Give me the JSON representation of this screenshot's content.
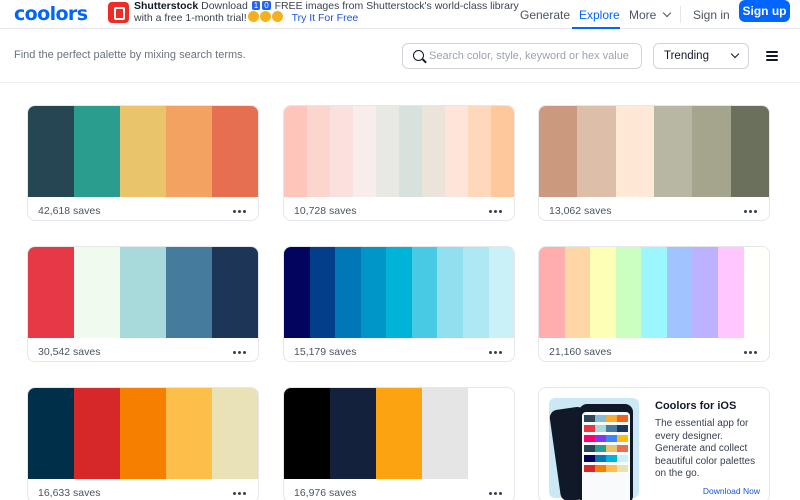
{
  "header": {
    "logo": "coolors",
    "ad": {
      "brand": "Shutterstock",
      "text_before": "Download",
      "counter": [
        "1",
        "0"
      ],
      "text_after": "FREE images from Shutterstock's world-class library",
      "line2": "with a free 1-month trial!",
      "cta": "Try It For Free"
    },
    "nav": {
      "generate": "Generate",
      "explore": "Explore",
      "more": "More",
      "signin": "Sign in",
      "signup": "Sign up"
    }
  },
  "filters": {
    "hint": "Find the perfect palette by mixing search terms.",
    "search_placeholder": "Search color, style, keyword or hex value",
    "sort": "Trending"
  },
  "palettes": [
    {
      "colors": [
        "#264653",
        "#2a9d8f",
        "#e9c46a",
        "#f4a261",
        "#e76f51"
      ],
      "saves": "42,618 saves"
    },
    {
      "colors": [
        "#fec5bb",
        "#fcd5ce",
        "#fae1dd",
        "#f8edeb",
        "#e8e8e4",
        "#d8e2dc",
        "#ece4db",
        "#ffe5d9",
        "#ffd7ba",
        "#fec89a"
      ],
      "saves": "10,728 saves"
    },
    {
      "colors": [
        "#cb997e",
        "#ddbea9",
        "#ffe8d6",
        "#b7b7a4",
        "#a5a58d",
        "#6b705c"
      ],
      "saves": "13,062 saves"
    },
    {
      "colors": [
        "#e63946",
        "#f1faee",
        "#a8dadc",
        "#457b9d",
        "#1d3557"
      ],
      "saves": "30,542 saves"
    },
    {
      "colors": [
        "#03045e",
        "#023e8a",
        "#0077b6",
        "#0096c7",
        "#00b4d8",
        "#48cae4",
        "#90e0ef",
        "#ade8f4",
        "#caf0f8"
      ],
      "saves": "15,179 saves"
    },
    {
      "colors": [
        "#ffadad",
        "#ffd6a5",
        "#fdffb6",
        "#caffbf",
        "#9bf6ff",
        "#a0c4ff",
        "#bdb2ff",
        "#ffc6ff",
        "#fffffc"
      ],
      "saves": "21,160 saves"
    },
    {
      "colors": [
        "#003049",
        "#d62828",
        "#f77f00",
        "#fcbf49",
        "#eae2b7"
      ],
      "saves": "16,633 saves"
    },
    {
      "colors": [
        "#000000",
        "#14213d",
        "#fca311",
        "#e5e5e5",
        "#ffffff"
      ],
      "saves": "16,976 saves"
    }
  ],
  "promo": {
    "title": "Coolors for iOS",
    "text": "The essential app for every designer. Generate and collect beautiful color palettes on the go.",
    "link": "Download Now"
  },
  "theme": {
    "accent": "#0066ff"
  }
}
